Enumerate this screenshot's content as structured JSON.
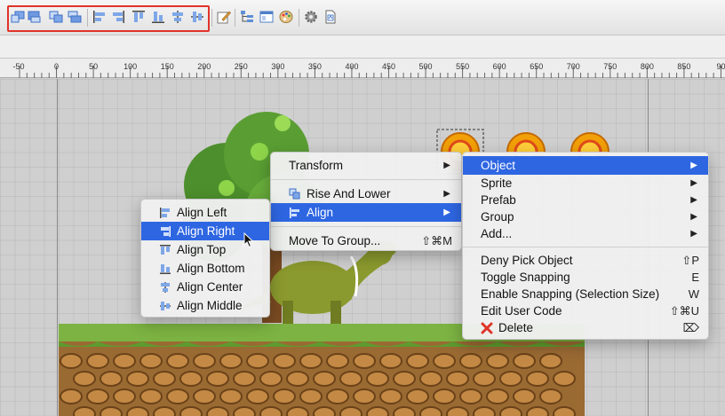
{
  "toolbar": {
    "highlighted_group": "arrange-align-tools",
    "buttons": [
      "layer-up-icon",
      "layer-top-icon",
      "layer-down-icon",
      "layer-bottom-icon",
      "align-left-icon",
      "align-right-icon",
      "align-top-icon",
      "align-bottom-icon",
      "align-center-icon",
      "align-middle-icon",
      "edit-icon",
      "hierarchy-icon",
      "properties-icon",
      "palette-icon",
      "settings-gear-icon",
      "document-icon"
    ]
  },
  "ruler": {
    "ticks": [
      "-50",
      "0",
      "50",
      "100",
      "150",
      "200",
      "250",
      "300",
      "350",
      "400",
      "450",
      "500",
      "550",
      "600",
      "650",
      "700",
      "750",
      "800",
      "850",
      "90"
    ]
  },
  "menus": {
    "main": {
      "items": [
        {
          "label": "Transform",
          "submenu": true
        },
        {
          "label": "Rise And Lower",
          "submenu": true,
          "icon": "rise-lower-icon"
        },
        {
          "label": "Align",
          "submenu": true,
          "icon": "align-icon",
          "selected": true
        },
        {
          "label": "Move To Group...",
          "shortcut": "⇧⌘M"
        }
      ]
    },
    "align": {
      "items": [
        {
          "label": "Align Left",
          "icon": "align-left-icon"
        },
        {
          "label": "Align Right",
          "icon": "align-right-icon",
          "selected": true
        },
        {
          "label": "Align Top",
          "icon": "align-top-icon"
        },
        {
          "label": "Align Bottom",
          "icon": "align-bottom-icon"
        },
        {
          "label": "Align Center",
          "icon": "align-center-icon"
        },
        {
          "label": "Align Middle",
          "icon": "align-middle-icon"
        }
      ]
    },
    "object": {
      "items": [
        {
          "label": "Object",
          "submenu": true,
          "selected": true
        },
        {
          "label": "Sprite",
          "submenu": true
        },
        {
          "label": "Prefab",
          "submenu": true
        },
        {
          "label": "Group",
          "submenu": true
        },
        {
          "label": "Add...",
          "submenu": true
        },
        {
          "label": "Deny Pick Object",
          "shortcut": "⇧P"
        },
        {
          "label": "Toggle Snapping",
          "shortcut": "E"
        },
        {
          "label": "Enable Snapping (Selection Size)",
          "shortcut": "W"
        },
        {
          "label": "Edit User Code",
          "shortcut": "⇧⌘U"
        },
        {
          "label": "Delete",
          "shortcut": "⌦",
          "icon": "delete-x-icon"
        }
      ]
    }
  },
  "colors": {
    "accent": "#2e66e2",
    "highlight_border": "#e0332a",
    "dirt": "#9a6a33",
    "grass": "#7cb342",
    "dino": "#8b9a2e",
    "coin": "#f2a007"
  }
}
